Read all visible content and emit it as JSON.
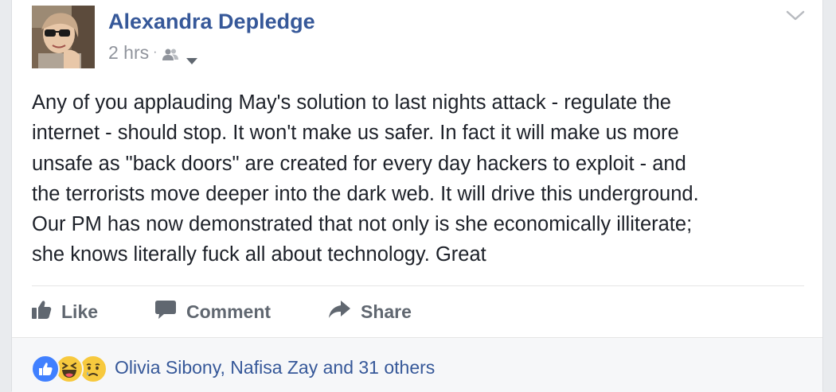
{
  "post": {
    "author": "Alexandra Depledge",
    "time": "2 hrs",
    "separator": "·",
    "audience_icon": "friends-icon",
    "lines": [
      "Any of you applauding May's solution to last nights attack - regulate the",
      "internet - should stop. It won't make us safer. In fact it will make us more",
      "unsafe as \"back doors\" are created for every day hackers to exploit - and",
      "the terrorists move deeper into the dark web. It will drive this underground.",
      "Our PM has now demonstrated that not only is she economically illiterate;",
      "she knows literally fuck all about technology. Great"
    ]
  },
  "actions": {
    "like": "Like",
    "comment": "Comment",
    "share": "Share"
  },
  "reactions": {
    "icons": [
      "like-reaction-icon",
      "haha-reaction-icon",
      "sad-reaction-icon"
    ],
    "summary": "Olivia Sibony, Nafisa Zay and 31 others"
  },
  "colors": {
    "link_blue": "#365899",
    "text": "#1d2129",
    "muted": "#90949c",
    "action_grey": "#606770",
    "like_blue": "#4080ff",
    "emoji_yellow": "#f7c93e"
  }
}
